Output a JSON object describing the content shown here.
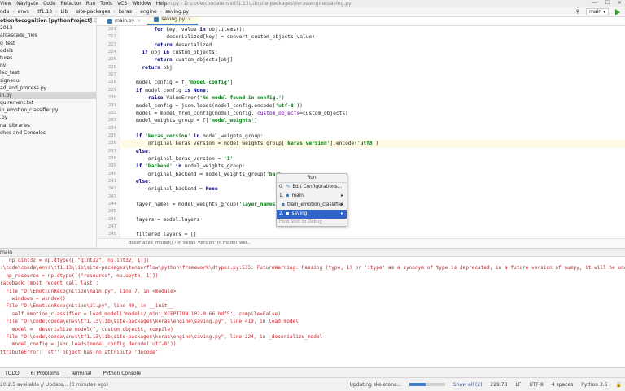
{
  "titlebar": {
    "menus": [
      "View",
      "Navigate",
      "Code",
      "Refactor",
      "Run",
      "Tools",
      "VCS",
      "Window",
      "Help"
    ],
    "title": "main.py - D:\\code\\conda\\envs\\tf1.13\\Lib\\site-packages\\keras\\engine\\saving.py"
  },
  "navbar": {
    "breadcrumb": [
      "nda",
      "envs",
      "tf1.13",
      "Lib",
      "site-packages",
      "keras",
      "engine",
      "saving.py"
    ],
    "run_config": "main"
  },
  "project": {
    "rows": [
      {
        "text": "otionRecognition [pythonProject]",
        "hint": " D:\\EmotionR",
        "bold": true
      },
      {
        "text": "2013"
      },
      {
        "text": "arcascade_files"
      },
      {
        "text": "g_test"
      },
      {
        "text": "odels"
      },
      {
        "text": "tures"
      },
      {
        "text": "nv"
      },
      {
        "text": "leo_test"
      },
      {
        "text": "signer.ui"
      },
      {
        "text": "ad_and_process.py"
      },
      {
        "text": "in.py",
        "selected": true
      },
      {
        "text": "quirement.txt"
      },
      {
        "text": "in_emotion_classifier.py"
      },
      {
        "text": ".py"
      },
      {
        "text": "nal Libraries"
      },
      {
        "text": "ches and Consoles"
      }
    ]
  },
  "tabs": [
    {
      "label": "main.py",
      "active": false
    },
    {
      "label": "saving.py",
      "active": true
    }
  ],
  "code": [
    {
      "ln": "221",
      "indent": 6,
      "parts": [
        [
          "kw",
          "for "
        ],
        [
          "",
          "key, value "
        ],
        [
          "kw",
          "in "
        ],
        [
          "",
          "obj.items():"
        ]
      ]
    },
    {
      "ln": "222",
      "indent": 10,
      "parts": [
        [
          "",
          "deserialized[key] = convert_custom_objects(value)"
        ]
      ]
    },
    {
      "ln": "223",
      "indent": 6,
      "parts": [
        [
          "kw",
          "return "
        ],
        [
          "",
          "deserialized"
        ]
      ]
    },
    {
      "ln": "224",
      "indent": 2,
      "parts": [
        [
          "kw",
          "if "
        ],
        [
          "",
          "obj "
        ],
        [
          "kw",
          "in "
        ],
        [
          "",
          "custom_objects:"
        ]
      ]
    },
    {
      "ln": "225",
      "indent": 6,
      "parts": [
        [
          "kw",
          "return "
        ],
        [
          "",
          "custom_objects[obj]"
        ]
      ]
    },
    {
      "ln": "226",
      "indent": 2,
      "parts": [
        [
          "kw",
          "return "
        ],
        [
          "",
          "obj"
        ]
      ]
    },
    {
      "ln": "227",
      "indent": 0,
      "parts": []
    },
    {
      "ln": "228",
      "indent": 0,
      "parts": [
        [
          "",
          "model_config = f["
        ],
        [
          "str",
          "'model_config'"
        ],
        [
          "",
          "]"
        ]
      ]
    },
    {
      "ln": "229",
      "indent": 0,
      "parts": [
        [
          "kw",
          "if "
        ],
        [
          "",
          "model_config "
        ],
        [
          "kw",
          "is "
        ],
        [
          "kw",
          "None"
        ],
        [
          "",
          ":"
        ]
      ]
    },
    {
      "ln": "230",
      "indent": 4,
      "parts": [
        [
          "kw",
          "raise "
        ],
        [
          "",
          "ValueError("
        ],
        [
          "str",
          "'No model found in config.'"
        ],
        [
          "",
          ")"
        ]
      ]
    },
    {
      "ln": "231",
      "indent": 0,
      "parts": [
        [
          "",
          "model_config = json.loads(model_config.encode("
        ],
        [
          "str",
          "'utf-8'"
        ],
        [
          "",
          "))"
        ]
      ]
    },
    {
      "ln": "232",
      "indent": 0,
      "parts": [
        [
          "",
          "model = model_from_config(model_config, "
        ],
        [
          "kwarg",
          "custom_objects"
        ],
        [
          "",
          "=custom_objects)"
        ]
      ]
    },
    {
      "ln": "233",
      "indent": 0,
      "parts": [
        [
          "",
          "model_weights_group = f["
        ],
        [
          "str",
          "'model_weights'"
        ],
        [
          "",
          "]"
        ]
      ]
    },
    {
      "ln": "234",
      "indent": 0,
      "parts": []
    },
    {
      "ln": "235",
      "indent": 0,
      "parts": [
        [
          "kw",
          "if "
        ],
        [
          "str",
          "'keras_version' "
        ],
        [
          "kw",
          "in "
        ],
        [
          "",
          "model_weights_group:"
        ]
      ]
    },
    {
      "ln": "236",
      "indent": 4,
      "hl": true,
      "parts": [
        [
          "",
          "original_keras_version = model_weights_group["
        ],
        [
          "str",
          "'keras_version'"
        ],
        [
          "",
          "].encode("
        ],
        [
          "str",
          "'utf8'"
        ],
        [
          "",
          ")"
        ]
      ]
    },
    {
      "ln": "237",
      "indent": 0,
      "parts": [
        [
          "kw",
          "else"
        ],
        [
          "",
          ":"
        ]
      ]
    },
    {
      "ln": "238",
      "indent": 4,
      "parts": [
        [
          "",
          "original_keras_version = "
        ],
        [
          "str",
          "'1'"
        ]
      ]
    },
    {
      "ln": "239",
      "indent": 0,
      "parts": [
        [
          "kw",
          "if "
        ],
        [
          "str",
          "'backend' "
        ],
        [
          "kw",
          "in "
        ],
        [
          "",
          "model_weights_group:"
        ]
      ]
    },
    {
      "ln": "240",
      "indent": 4,
      "parts": [
        [
          "",
          "original_backend = model_weights_group["
        ],
        [
          "str",
          "'back"
        ]
      ]
    },
    {
      "ln": "241",
      "indent": 0,
      "parts": [
        [
          "kw",
          "else"
        ],
        [
          "",
          ":"
        ]
      ]
    },
    {
      "ln": "242",
      "indent": 4,
      "parts": [
        [
          "",
          "original_backend = "
        ],
        [
          "kw",
          "None"
        ]
      ]
    },
    {
      "ln": "243",
      "indent": 0,
      "parts": []
    },
    {
      "ln": "244",
      "indent": 0,
      "parts": [
        [
          "",
          "layer_names = model_weights_group["
        ],
        [
          "str",
          "'layer_names'"
        ],
        [
          "",
          "]"
        ]
      ]
    },
    {
      "ln": "245",
      "indent": 0,
      "parts": []
    },
    {
      "ln": "246",
      "indent": 0,
      "parts": [
        [
          "",
          "layers = model.layers"
        ]
      ]
    },
    {
      "ln": "247",
      "indent": 0,
      "parts": []
    },
    {
      "ln": "248",
      "indent": 0,
      "parts": [
        [
          "",
          "filtered_layers = []"
        ]
      ]
    }
  ],
  "editor_breadcrumb": "_deserialize_model()   ›   if 'keras_version' in model_wei...",
  "popup": {
    "title": "Run",
    "items": [
      {
        "prefix": "0.",
        "label": "Edit Configurations...",
        "arrow": ""
      },
      {
        "prefix": "1.",
        "label": "main",
        "arrow": "▸"
      },
      {
        "prefix": "",
        "label": "train_emotion_classifier",
        "arrow": "▸"
      },
      {
        "prefix": "2.",
        "label": "saving",
        "arrow": "▸",
        "selected": true
      }
    ],
    "footer": "Hold Shift to Debug"
  },
  "run_header": "main",
  "output": [
    {
      "t": "  _np_qint32 = np.dtype([(\"qint32\", np.int32, 1)])",
      "err": true
    },
    {
      "t": ":\\code\\conda\\envs\\tf1.13\\lib\\site-packages\\tensorflow\\python\\framework\\dtypes.py:535: FutureWarning: Passing (type, 1) or '1type' as a synonym of type is deprecated; in a future version of numpy, it will be underst",
      "err": true
    },
    {
      "t": "  np_resource = np.dtype([(\"resource\", np.ubyte, 1)])",
      "err": true
    },
    {
      "t": "raceback (most recent call last):",
      "err": true
    },
    {
      "t": "  File \"D:\\EmotionRecognition\\main.py\", line 7, in <module>",
      "err": true
    },
    {
      "t": "    windows = window()",
      "err": true
    },
    {
      "t": "  File \"D:\\EmotionRecognition\\UI.py\", line 40, in __init__",
      "err": true
    },
    {
      "t": "    self.emotion_classifier = load_model('models/_mini_XCEPTION.102-0.66.hdf5', compile=False)",
      "err": true
    },
    {
      "t": "  File \"D:\\code\\conda\\envs\\tf1.13\\lib\\site-packages\\keras\\engine\\saving.py\", line 419, in load_model",
      "err": true
    },
    {
      "t": "    model = _deserialize_model(f, custom_objects, compile)",
      "err": true
    },
    {
      "t": "  File \"D:\\code\\conda\\envs\\tf1.13\\lib\\site-packages\\keras\\engine\\saving.py\", line 224, in _deserialize_model",
      "err": true
    },
    {
      "t": "    model_config = json.loads(model_config.decode('utf-8'))",
      "err": true
    },
    {
      "t": "ttributeError: 'str' object has no attribute 'decode'",
      "err": true
    }
  ],
  "bottom_tools": [
    "TODO",
    "6: Problems",
    "Terminal",
    "Python Console"
  ],
  "status": {
    "left": "20.2.5 available // Update... (3 minutes ago)",
    "progress_text": "Updating skeletons...",
    "progress": 0.45,
    "show_all": "Show all (2)",
    "position": "229:73",
    "line_sep": "LF",
    "encoding": "UTF-8",
    "indent": "4 spaces",
    "interpreter": "Python 3.6"
  }
}
